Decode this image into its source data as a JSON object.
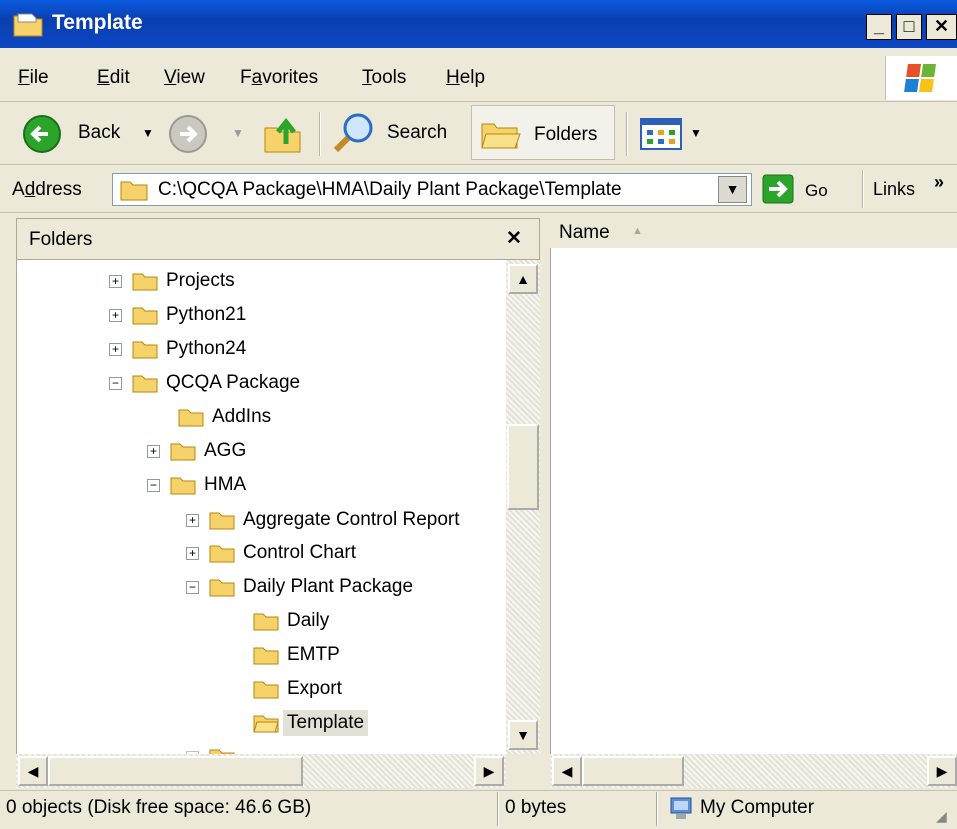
{
  "window": {
    "title": "Template",
    "minimize_label": "_",
    "maximize_label": "□",
    "close_label": "✕"
  },
  "menu": [
    {
      "label": "File",
      "accel": "F",
      "rest": "ile"
    },
    {
      "label": "Edit",
      "accel": "E",
      "rest": "dit"
    },
    {
      "label": "View",
      "accel": "V",
      "rest": "iew"
    },
    {
      "label": "Favorites",
      "pre": "F",
      "accel": "a",
      "rest": "vorites"
    },
    {
      "label": "Tools",
      "accel": "T",
      "rest": "ools"
    },
    {
      "label": "Help",
      "accel": "H",
      "rest": "elp"
    }
  ],
  "toolbar": {
    "back_label": "Back",
    "search_label": "Search",
    "folders_label": "Folders"
  },
  "address": {
    "label_pre": "A",
    "label_accel": "d",
    "label_rest": "dress",
    "value": "C:\\QCQA Package\\HMA\\Daily Plant Package\\Template",
    "go_label": "Go",
    "links_label": "Links",
    "links_chevron": "»"
  },
  "folders_pane": {
    "title": "Folders",
    "close_label": "✕",
    "items": [
      {
        "label": "Projects",
        "expander": "+"
      },
      {
        "label": "Python21",
        "expander": "+"
      },
      {
        "label": "Python24",
        "expander": "+"
      },
      {
        "label": "QCQA Package",
        "expander": "−"
      },
      {
        "label": "AddIns",
        "expander": ""
      },
      {
        "label": "AGG",
        "expander": "+"
      },
      {
        "label": "HMA",
        "expander": "−"
      },
      {
        "label": "Aggregate Control Report",
        "expander": "+"
      },
      {
        "label": "Control Chart",
        "expander": "+"
      },
      {
        "label": "Daily Plant Package",
        "expander": "−"
      },
      {
        "label": "Daily",
        "expander": ""
      },
      {
        "label": "EMTP",
        "expander": ""
      },
      {
        "label": "Export",
        "expander": ""
      },
      {
        "label": "Template",
        "expander": "",
        "selected": true
      }
    ]
  },
  "list": {
    "column_name": "Name",
    "sort_indicator": "▲"
  },
  "status": {
    "objects": "0 objects (Disk free space: 46.6 GB)",
    "size": "0 bytes",
    "zone": "My Computer"
  },
  "colors": {
    "titlebar": "#0a4fd0",
    "folder_yellow": "#f5d36a",
    "go_green": "#2aa52a"
  }
}
